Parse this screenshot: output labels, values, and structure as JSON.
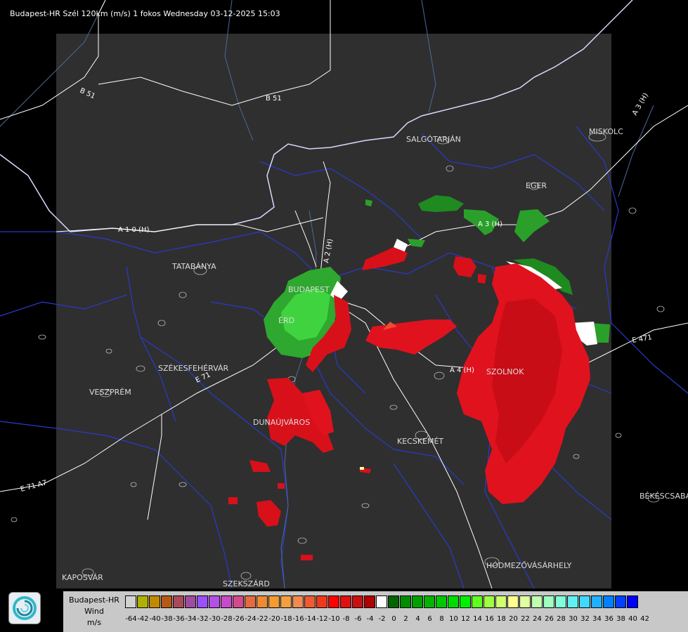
{
  "header": {
    "title": "Budapest-HR Szél 120km (m/s) 1 fokos Wednesday 03-12-2025 15:03"
  },
  "cities": [
    {
      "name": "SALGÓTARJÁN"
    },
    {
      "name": "MISKOLC"
    },
    {
      "name": "EGER"
    },
    {
      "name": "TATABÁNYA"
    },
    {
      "name": "BUDAPEST"
    },
    {
      "name": "ÉRD"
    },
    {
      "name": "SZÉKESFEHÉRVÁR"
    },
    {
      "name": "VESZPRÉM"
    },
    {
      "name": "DUNAÚJVÁROS"
    },
    {
      "name": "KECSKEMÉT"
    },
    {
      "name": "SZOLNOK"
    },
    {
      "name": "BÉKÉSCSABA"
    },
    {
      "name": "HÓDMEZŐVÁSÁRHELY"
    },
    {
      "name": "KAPOSVÁR"
    },
    {
      "name": "SZEKSZÁRD"
    }
  ],
  "roads": [
    {
      "name": "B 51"
    },
    {
      "name": "B 51"
    },
    {
      "name": "A 1 0 (H)"
    },
    {
      "name": "A 2 (H)"
    },
    {
      "name": "A 3 (H)"
    },
    {
      "name": "A 3 (H)"
    },
    {
      "name": "A 4 (H)"
    },
    {
      "name": "E 471"
    },
    {
      "name": "E 71"
    },
    {
      "name": "E 71 A7"
    }
  ],
  "legend": {
    "title_line1": "Budapest-HR",
    "title_line2": "Wind",
    "title_line3": "m/s",
    "colors": [
      "#d2d2d2",
      "#b0b000",
      "#c08a00",
      "#b45a14",
      "#a84a5a",
      "#a04aa0",
      "#9a50ff",
      "#b450e6",
      "#c84ac8",
      "#d24a8c",
      "#e66a40",
      "#ee8a30",
      "#f49a30",
      "#f4a040",
      "#f08a50",
      "#f05a30",
      "#ee3a1a",
      "#ff0000",
      "#e01010",
      "#c81010",
      "#b00000",
      "#ffffff",
      "#006400",
      "#008c00",
      "#00a000",
      "#00b400",
      "#00c800",
      "#00dc00",
      "#00f000",
      "#60ff20",
      "#a0ff40",
      "#d0ff70",
      "#ffff90",
      "#e0ffa0",
      "#c0ffb0",
      "#a0ffc0",
      "#80ffd8",
      "#60f0f0",
      "#40d8ff",
      "#20b0ff",
      "#0080ff",
      "#0040ff",
      "#0000ff"
    ],
    "ticks": [
      "-64",
      "-42",
      "-40",
      "-38",
      "-36",
      "-34",
      "-32",
      "-30",
      "-28",
      "-26",
      "-24",
      "-22",
      "-20",
      "-18",
      "-16",
      "-14",
      "-12",
      "-10",
      "-8",
      "-6",
      "-4",
      "-2",
      "0",
      "2",
      "4",
      "6",
      "8",
      "10",
      "12",
      "14",
      "16",
      "18",
      "20",
      "22",
      "24",
      "26",
      "28",
      "30",
      "32",
      "34",
      "36",
      "38",
      "40",
      "42"
    ]
  }
}
